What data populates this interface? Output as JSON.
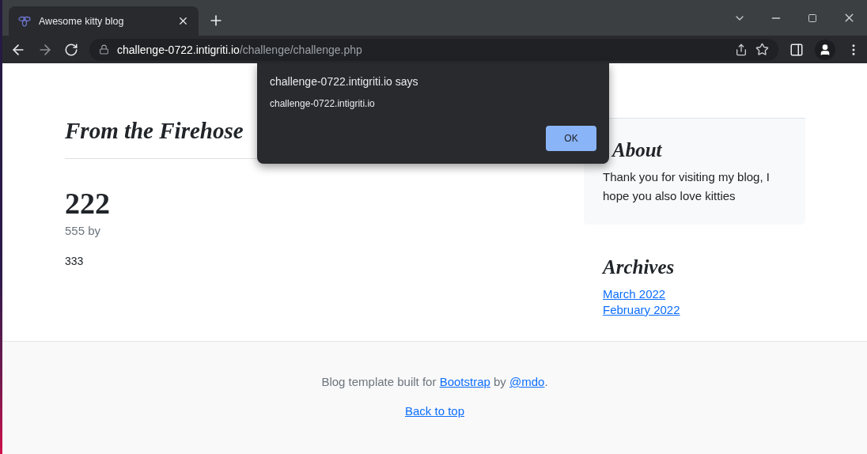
{
  "browser": {
    "tabs": [
      {
        "title": "Awesome kitty blog",
        "selected": true
      }
    ],
    "address": {
      "host": "challenge-0722.intigriti.io",
      "path": "/challenge/challenge.php"
    }
  },
  "dialog": {
    "title": "challenge-0722.intigriti.io says",
    "message": "challenge-0722.intigriti.io",
    "button": "OK"
  },
  "page": {
    "section_title": "From the Firehose",
    "post": {
      "title": "222",
      "meta": "555 by",
      "body": "333"
    },
    "about": {
      "title": "About",
      "text": "Thank you for visiting my blog, I hope you also love kitties"
    },
    "archives": {
      "title": "Archives",
      "links": [
        "March 2022",
        "February 2022"
      ]
    },
    "footer": {
      "credit": [
        {
          "kind": "text",
          "text": "Blog template built for "
        },
        {
          "kind": "link",
          "text": "Bootstrap"
        },
        {
          "kind": "text",
          "text": " by "
        },
        {
          "kind": "link",
          "text": "@mdo"
        },
        {
          "kind": "text",
          "text": "."
        }
      ],
      "back_link": "Back to top"
    }
  }
}
